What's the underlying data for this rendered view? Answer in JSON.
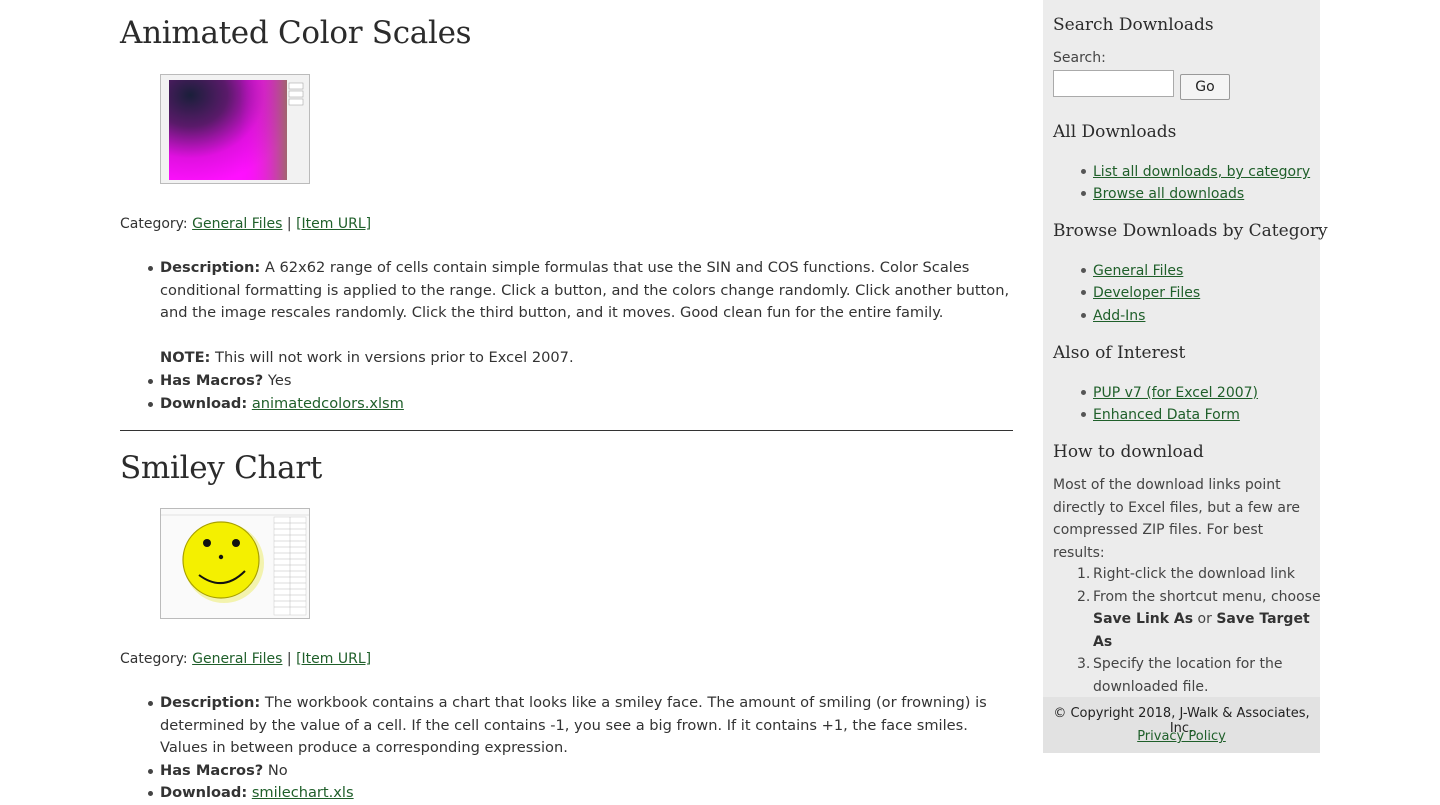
{
  "items": [
    {
      "title": "Animated Color Scales",
      "thumbnail": "animated-color-scales-thumbnail",
      "category_label": "Category:",
      "category_link": "General Files",
      "separator": "|",
      "item_url": "[Item URL]",
      "description_label": "Description:",
      "description": "A 62x62 range of cells contain simple formulas that use the SIN and COS functions. Color Scales conditional formatting is applied to the range. Click a button, and the colors change randomly. Click another button, and the image rescales randomly. Click the third button, and it moves. Good clean fun for the entire family.",
      "note_label": "NOTE:",
      "note": "This will not work in versions prior to Excel 2007.",
      "macros_label": "Has Macros?",
      "macros": "Yes",
      "download_label": "Download:",
      "download": "animatedcolors.xlsm"
    },
    {
      "title": "Smiley Chart",
      "thumbnail": "smiley-chart-thumbnail",
      "category_label": "Category:",
      "category_link": "General Files",
      "separator": "|",
      "item_url": "[Item URL]",
      "description_label": "Description:",
      "description": "The workbook contains a chart that looks like a smiley face. The amount of smiling (or frowning) is determined by the value of a cell. If the cell contains -1, you see a big frown. If it contains +1, the face smiles. Values in between produce a corresponding expression.",
      "macros_label": "Has Macros?",
      "macros": "No",
      "download_label": "Download:",
      "download": "smilechart.xls"
    }
  ],
  "sidebar": {
    "search_heading": "Search Downloads",
    "search_label": "Search:",
    "search_value": "",
    "go_label": "Go",
    "all_heading": "All Downloads",
    "all_links": [
      "List all downloads, by category",
      "Browse all downloads"
    ],
    "browse_heading": "Browse Downloads by Category",
    "browse_links": [
      "General Files",
      "Developer Files",
      "Add-Ins"
    ],
    "also_heading": "Also of Interest",
    "also_links": [
      "PUP v7 (for Excel 2007)",
      "Enhanced Data Form"
    ],
    "howto_heading": "How to download",
    "howto_text": "Most of the download links point directly to Excel files, but a few are compressed ZIP files. For best results:",
    "steps": {
      "s1_num": "1.",
      "s1": "Right-click the download link",
      "s2_num": "2.",
      "s2_pre": "From the shortcut menu, choose",
      "s2_b1": "Save Link As",
      "s2_mid": "or",
      "s2_b2": "Save Target As",
      "s3_num": "3.",
      "s3": "Specify the location for the downloaded file."
    },
    "copyright": "© Copyright 2018, J-Walk & Associates, Inc.",
    "privacy": "Privacy Policy"
  },
  "colors": {
    "link": "#1f5f2a",
    "sidebar_bg": "#ececec",
    "footer_bg": "#e2e2e2"
  }
}
